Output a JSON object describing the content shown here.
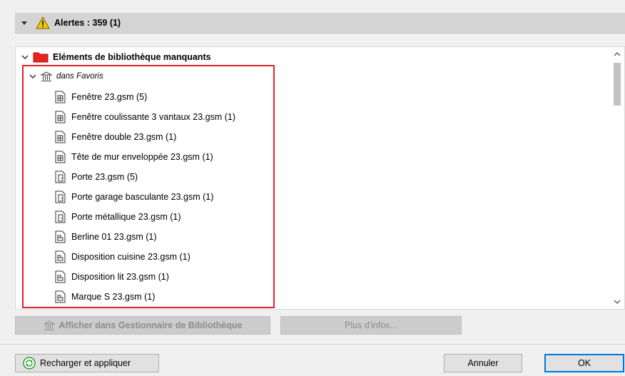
{
  "header": {
    "title": "Alertes : 359 (1)"
  },
  "tree": {
    "root_label": "Eléments de bibliothèque manquants",
    "group_label": "dans Favoris",
    "items": [
      {
        "label": "Fenêtre 23.gsm (5)",
        "icon": "window-object-icon"
      },
      {
        "label": "Fenêtre coulissante 3 vantaux 23.gsm (1)",
        "icon": "window-object-icon"
      },
      {
        "label": "Fenêtre double 23.gsm (1)",
        "icon": "window-object-icon"
      },
      {
        "label": "Tête de mur enveloppée 23.gsm (1)",
        "icon": "window-object-icon"
      },
      {
        "label": "Porte 23.gsm (5)",
        "icon": "door-object-icon"
      },
      {
        "label": "Porte garage basculante 23.gsm (1)",
        "icon": "door-object-icon"
      },
      {
        "label": "Porte métallique 23.gsm (1)",
        "icon": "door-object-icon"
      },
      {
        "label": "Berline 01 23.gsm (1)",
        "icon": "object-icon"
      },
      {
        "label": "Disposition cuisine 23.gsm (1)",
        "icon": "object-icon"
      },
      {
        "label": "Disposition lit 23.gsm (1)",
        "icon": "object-icon"
      },
      {
        "label": "Marque S 23.gsm (1)",
        "icon": "object-icon"
      }
    ]
  },
  "buttons": {
    "afficher": "Afficher dans Gestionnaire de Bibliothèque",
    "plus_infos": "Plus d'infos...",
    "recharger": "Recharger et appliquer",
    "annuler": "Annuler",
    "ok": "OK"
  },
  "colors": {
    "highlight_border": "#e0202a",
    "folder": "#e8231f",
    "warning": "#f5c800",
    "ok_border": "#0078d7"
  }
}
